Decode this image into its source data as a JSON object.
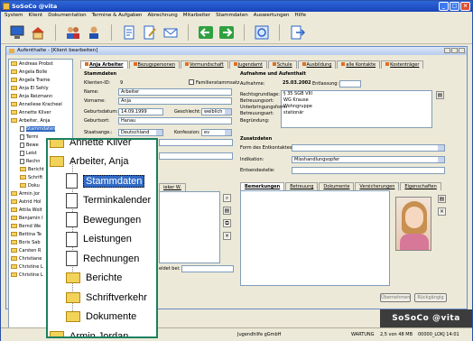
{
  "app": {
    "title": "SoSoCo @vita"
  },
  "menu": [
    "System",
    "Klient",
    "Dokumentation",
    "Termine & Aufgaben",
    "Abrechnung",
    "Mitarbeiter",
    "Stammdaten",
    "Auswertungen",
    "Hilfe"
  ],
  "child_window": {
    "title": "Aufenthalte - [Klient bearbeiten]"
  },
  "tree": {
    "items": [
      {
        "label": "Andreas Probst",
        "type": "folder",
        "level": 0
      },
      {
        "label": "Angela Bolle",
        "type": "folder",
        "level": 0
      },
      {
        "label": "Angela Trame",
        "type": "folder",
        "level": 0
      },
      {
        "label": "Anja El Sehly",
        "type": "folder",
        "level": 0
      },
      {
        "label": "Anja Reizmann",
        "type": "folder",
        "level": 0
      },
      {
        "label": "Anneliese Kracheel",
        "type": "folder",
        "level": 0
      },
      {
        "label": "Annette Kliver",
        "type": "folder",
        "level": 0
      },
      {
        "label": "Arbeiter, Anja",
        "type": "folder",
        "level": 0
      },
      {
        "label": "Stammdaten",
        "type": "doc",
        "level": 1,
        "selected": true
      },
      {
        "label": "Termi",
        "type": "doc",
        "level": 1
      },
      {
        "label": "Bewe",
        "type": "doc",
        "level": 1
      },
      {
        "label": "Leist",
        "type": "doc",
        "level": 1
      },
      {
        "label": "Rechn",
        "type": "doc",
        "level": 1
      },
      {
        "label": "Bericht",
        "type": "folder",
        "level": 1
      },
      {
        "label": "Schrift",
        "type": "folder",
        "level": 1
      },
      {
        "label": "Doku",
        "type": "folder",
        "level": 1
      },
      {
        "label": "Armin Jor",
        "type": "folder",
        "level": 0
      },
      {
        "label": "Astrid Hol",
        "type": "folder",
        "level": 0
      },
      {
        "label": "Attila Wolt",
        "type": "folder",
        "level": 0
      },
      {
        "label": "Benjamin I",
        "type": "folder",
        "level": 0
      },
      {
        "label": "Bernd We",
        "type": "folder",
        "level": 0
      },
      {
        "label": "Bettina Te",
        "type": "folder",
        "level": 0
      },
      {
        "label": "Boris Sab",
        "type": "folder",
        "level": 0
      },
      {
        "label": "Carsten R",
        "type": "folder",
        "level": 0
      },
      {
        "label": "Christiane",
        "type": "folder",
        "level": 0
      },
      {
        "label": "Christine L",
        "type": "folder",
        "level": 0
      },
      {
        "label": "Christine L",
        "type": "folder",
        "level": 0
      }
    ]
  },
  "zoom": {
    "items": [
      {
        "label": "Annette Kliver",
        "type": "folder",
        "level": 0
      },
      {
        "label": "Arbeiter, Anja",
        "type": "folder-open",
        "level": 0
      },
      {
        "label": "Stammdaten",
        "type": "doc",
        "level": 1,
        "selected": true
      },
      {
        "label": "Terminkalender",
        "type": "doc",
        "level": 1
      },
      {
        "label": "Bewegungen",
        "type": "doc",
        "level": 1
      },
      {
        "label": "Leistungen",
        "type": "doc",
        "level": 1
      },
      {
        "label": "Rechnungen",
        "type": "doc",
        "level": 1
      },
      {
        "label": "Berichte",
        "type": "folder",
        "level": 1
      },
      {
        "label": "Schriftverkehr",
        "type": "folder",
        "level": 1
      },
      {
        "label": "Dokumente",
        "type": "folder",
        "level": 1
      },
      {
        "label": "Armin Jordan",
        "type": "folder",
        "level": 0
      }
    ]
  },
  "tabs": [
    "Anja Arbeiter",
    "Bezugspersonen",
    "Vormundschaft",
    "Jugendamt",
    "Schule",
    "Ausbildung",
    "alle Kontakte",
    "Kostenträger"
  ],
  "stammdaten": {
    "header": "Stammdaten",
    "klienten_id_label": "Klienten-ID:",
    "klienten_id": "9",
    "familienstammsatz": "Familienstammsatz",
    "name_label": "Name:",
    "name": "Arbeiter",
    "vorname_label": "Vorname:",
    "vorname": "Anja",
    "geburtsdatum_label": "Geburtsdatum:",
    "geburtsdatum": "14.09.1999",
    "geschlecht_label": "Geschlecht:",
    "geschlecht": "weiblich",
    "geburtsort_label": "Geburtsort:",
    "geburtsort": "Hanau",
    "staatsange_label": "Staatsange.:",
    "staatsange": "Deutschland",
    "konfession_label": "Konfession:",
    "konfession": "ev"
  },
  "aufnahme": {
    "header": "Aufnahme und Aufenthalt",
    "aufnahme_label": "Aufnahme:",
    "aufnahme": "25.03.2002",
    "entlassung_label": "Entlassung:",
    "entlassung": "",
    "rechtsgrundlage_label": "Rechtsgrundlage:",
    "rechtsgrundlage": "§ 35 SGB VIII",
    "betreuungsort_label": "Betreuungsort:",
    "betreuungsort": "WG Krause",
    "unterbringungsform_label": "Unterbringungsform:",
    "unterbringungsform": "Wohngruppe",
    "betreuungsart_label": "Betreuungsart:",
    "betreuungsart": "stationär",
    "begruendung_label": "Begründung:"
  },
  "zusatz": {
    "header": "Zusatzdaten",
    "entlass_label": "Form des Entkontaktes:",
    "indikation_label": "Indikation:",
    "indikation": "Misshandlungsopfer",
    "entsender_label": "Entsendestelle:"
  },
  "lower_tabs": [
    "Bemerkungen",
    "Betreuung",
    "Dokumente",
    "Versicherungen",
    "Eigenschaften"
  ],
  "lower_left": {
    "tab_label": "ieker W.",
    "geaendert_label": "eldet bei:"
  },
  "buttons": {
    "uebernehmen": "Übernehmen",
    "rueckgaengig": "Rückgängig"
  },
  "status": {
    "company": "Jugendhilfe gGmbH",
    "wartung": "WARTUNG",
    "mem": "2,5 von 48 MB",
    "user": "00000_LOKJ 14:01"
  }
}
